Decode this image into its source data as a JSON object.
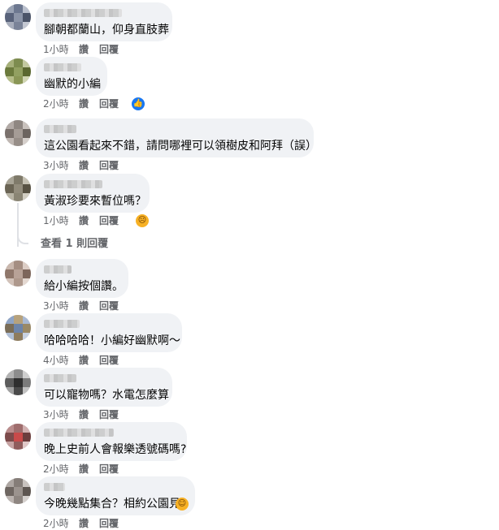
{
  "comments": [
    {
      "text": "腳朝都蘭山，仰身直肢葬",
      "time": "1小時",
      "like": "讚",
      "reply": "回覆",
      "reaction": ""
    },
    {
      "text": "幽默的小編",
      "time": "2小時",
      "like": "讚",
      "reply": "回覆",
      "reaction": "like-icon"
    },
    {
      "text": "這公園看起來不錯，請問哪裡可以領樹皮和阿拜（誤）",
      "time": "3小時",
      "like": "讚",
      "reply": "回覆",
      "reaction": ""
    },
    {
      "text": "黃淑珍要來暫位嗎？",
      "time": "1小時",
      "like": "讚",
      "reply": "回覆",
      "reaction": "sad-face-icon"
    },
    {
      "text": "給小編按個讚。",
      "time": "3小時",
      "like": "讚",
      "reply": "回覆",
      "reaction": ""
    },
    {
      "text": "哈哈哈哈！小編好幽默啊～",
      "time": "4小時",
      "like": "讚",
      "reply": "回覆",
      "reaction": ""
    },
    {
      "text": "可以寵物嗎？水電怎麼算",
      "time": "3小時",
      "like": "讚",
      "reply": "回覆",
      "reaction": ""
    },
    {
      "text": "晚上史前人會報樂透號碼嗎?",
      "time": "2小時",
      "like": "讚",
      "reply": "回覆",
      "reaction": ""
    },
    {
      "text": "今晚幾點集合？相約公園見",
      "time": "2小時",
      "like": "讚",
      "reply": "回覆",
      "reaction": "laughing-face-icon"
    }
  ],
  "view_replies": "查看 1 則回覆",
  "colors": {
    "bubble_bg": "#f0f2f5",
    "meta_text": "#65676b",
    "like_blue": "#1877f2"
  }
}
